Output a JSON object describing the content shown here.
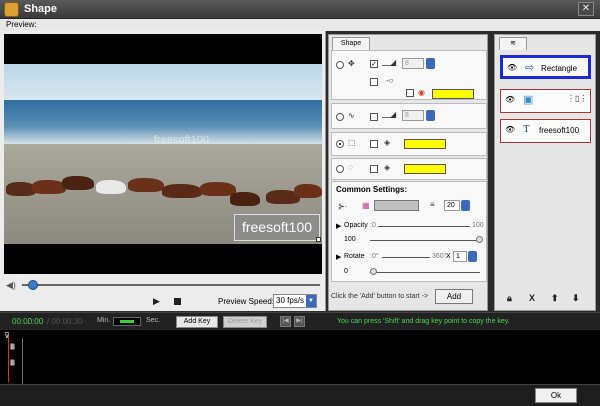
{
  "window": {
    "title": "Shape",
    "close_glyph": "✕"
  },
  "preview": {
    "label": "Preview:",
    "watermark": "freesoft100",
    "overlay_text": "freesoft100",
    "speed_label": "Preview Speed:",
    "speed_value": "30 fps/s"
  },
  "shape_panel": {
    "tab": "Shape",
    "row1_value": "8",
    "row2_value": "8",
    "common_settings": "Common Settings:",
    "border_width": "20",
    "opacity_label": "Opacity",
    "opacity_min": ":0",
    "opacity_max": "100",
    "opacity_value": "100",
    "rotate_label": "Rotate",
    "rotate_min": ":0°",
    "rotate_max": "360°",
    "rotate_mult": "X",
    "rotate_count": "1",
    "rotate_value": "0",
    "hint": "Click the 'Add' button to start ->",
    "add_button": "Add",
    "fill_color": "#ffff00"
  },
  "layers": {
    "items": [
      {
        "label": "Rectangle",
        "icon": "arrow-shape-icon",
        "selected": true
      },
      {
        "label": "",
        "icon": "image-icon",
        "selected": false
      },
      {
        "label": "freesoft100",
        "icon": "text-T-icon",
        "selected": false
      }
    ],
    "tools": [
      "lock-icon",
      "delete-icon",
      "move-up-icon",
      "move-down-icon"
    ]
  },
  "timeline": {
    "current_time": "00:00:00",
    "total_time": "/ 00:00:30",
    "min_label": "Min.",
    "sec_label": "Sec.",
    "add_key": "Add Key",
    "delete_key": "Delete Key",
    "hint": "You can press 'Shift' and drag key point to copy the key."
  },
  "ok_button": "Ok"
}
